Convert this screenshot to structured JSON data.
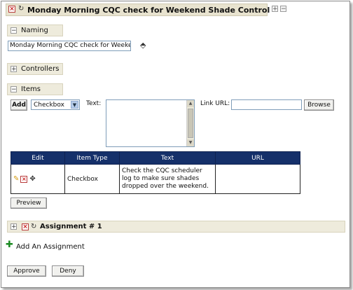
{
  "window": {
    "title": "Monday Morning CQC check for Weekend Shade Control"
  },
  "naming": {
    "header": "Naming",
    "name_value": "Monday Morning CQC check for Weekend"
  },
  "controllers": {
    "header": "Controllers"
  },
  "items": {
    "header": "Items",
    "add_label": "Add",
    "type_selected": "Checkbox",
    "text_label": "Text:",
    "link_url_label": "Link URL:",
    "link_url_value": "",
    "browse_label": "Browse",
    "table": {
      "headers": [
        "Edit",
        "Item Type",
        "Text",
        "URL"
      ],
      "rows": [
        {
          "item_type": "Checkbox",
          "text_line1": "Check the CQC scheduler",
          "text_line2": "log to make sure shades",
          "text_line3": "dropped over the weekend.",
          "url": ""
        }
      ]
    },
    "preview_label": "Preview"
  },
  "assignment": {
    "header": "Assignment # 1"
  },
  "add_assignment_label": "Add An Assignment",
  "footer": {
    "approve_label": "Approve",
    "deny_label": "Deny"
  },
  "colors": {
    "table_header_bg": "#15306a",
    "section_header_bg": "#eeebdc",
    "close_red": "#c81e1e",
    "add_green": "#1b8a22"
  }
}
